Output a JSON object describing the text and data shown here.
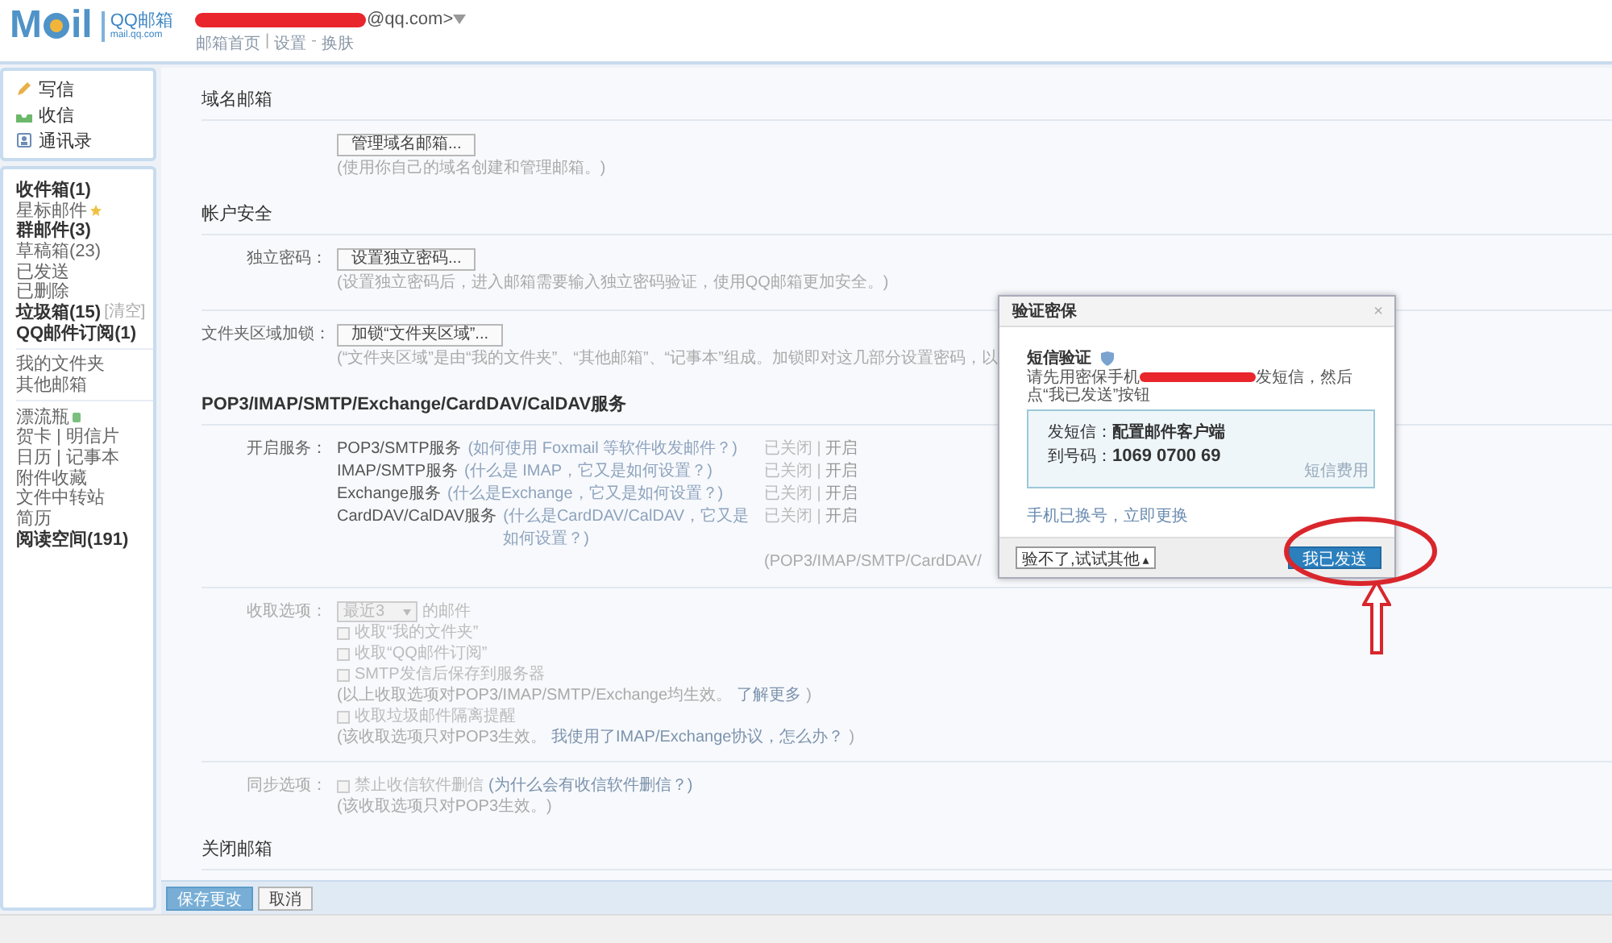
{
  "header": {
    "logo_left": "M",
    "logo_right": "il",
    "brand": "QQ邮箱",
    "brand_sub": "mail.qq.com",
    "account_suffix": "@qq.com>",
    "nav": [
      {
        "label": "邮箱首页",
        "sep": "|"
      },
      {
        "label": "设置",
        "sep": "-"
      },
      {
        "label": "换肤"
      }
    ]
  },
  "sidebar": {
    "actions": [
      {
        "kind": "write",
        "label": "写信"
      },
      {
        "kind": "receive",
        "label": "收信"
      },
      {
        "kind": "contacts",
        "label": "通讯录"
      }
    ],
    "groups": [
      [
        {
          "label": "收件箱(1)",
          "unread": true
        },
        {
          "label": "星标邮件",
          "unread": false,
          "star": true
        },
        {
          "label": "群邮件(3)",
          "unread": true
        },
        {
          "label": "草稿箱(23)",
          "unread": false
        },
        {
          "label": "已发送",
          "unread": false
        },
        {
          "label": "已删除",
          "unread": false
        },
        {
          "label": "垃圾箱(15)",
          "unread": true,
          "extra": "[清空]"
        },
        {
          "label": "QQ邮件订阅(1)",
          "unread": true
        }
      ],
      [
        {
          "label": "我的文件夹",
          "unread": false
        },
        {
          "label": "其他邮箱",
          "unread": false
        }
      ],
      [
        {
          "label": "漂流瓶",
          "unread": false,
          "bottle": true
        },
        {
          "label": "贺卡 | 明信片",
          "unread": false
        },
        {
          "label": "日历 | 记事本",
          "unread": false
        },
        {
          "label": "附件收藏",
          "unread": false
        },
        {
          "label": "文件中转站",
          "unread": false
        },
        {
          "label": "简历",
          "unread": false
        },
        {
          "label": "阅读空间(191)",
          "unread": true
        }
      ]
    ]
  },
  "sections": [
    {
      "title": "域名邮箱",
      "rows": [
        {
          "button": "管理域名邮箱...",
          "note": "(使用你自己的域名创建和管理邮箱。)"
        }
      ]
    },
    {
      "title": "帐户安全",
      "rows": [
        {
          "label": "独立密码：",
          "button": "设置独立密码...",
          "note": "(设置独立密码后，进入邮箱需要输入独立密码验证，使用QQ邮箱更加安全。)"
        },
        {
          "label": "文件夹区域加锁：",
          "button": "加锁“文件夹区域”...",
          "note": "(“文件夹区域”是由“我的文件夹”、“其他邮箱”、“记事本”组成。加锁即对这几部分设置密码，以"
        }
      ]
    },
    {
      "title": "POP3/IMAP/SMTP/Exchange/CardDAV/CalDAV服务",
      "services_label": "开启服务：",
      "services": [
        {
          "name": "POP3/SMTP服务",
          "hint": "(如何使用 Foxmail 等软件收发邮件？)",
          "status": "已关闭",
          "sep": "|",
          "action": "开启"
        },
        {
          "name": "IMAP/SMTP服务",
          "hint": "(什么是 IMAP，它又是如何设置？)",
          "status": "已关闭",
          "sep": "|",
          "action": "开启"
        },
        {
          "name": "Exchange服务",
          "hint": "(什么是Exchange，它又是如何设置？)",
          "status": "已关闭",
          "sep": "|",
          "action": "开启"
        },
        {
          "name": "CardDAV/CalDAV服务",
          "hint": "(什么是CardDAV/CalDAV，它又是如何设置？)",
          "status": "已关闭",
          "sep": "|",
          "action": "开启"
        }
      ],
      "services_note": "(POP3/IMAP/SMTP/CardDAV/",
      "receive": {
        "label": "收取选项：",
        "disabled": true,
        "select": "最近3",
        "select_suffix": "的邮件",
        "items": [
          {
            "kind": "checkbox",
            "label": "收取“我的文件夹”",
            "checked": false
          },
          {
            "kind": "checkbox",
            "label": "收取“QQ邮件订阅”",
            "checked": false
          },
          {
            "kind": "checkbox",
            "label": "SMTP发信后保存到服务器",
            "checked": false
          },
          {
            "kind": "note",
            "text": "(以上收取选项对POP3/IMAP/SMTP/Exchange均生效。",
            "link": "了解更多",
            "tail": ")"
          },
          {
            "kind": "checkbox",
            "label": "收取垃圾邮件隔离提醒",
            "checked": false
          },
          {
            "kind": "note",
            "text": "(该收取选项只对POP3生效。",
            "link": "我使用了IMAP/Exchange协议，怎么办？",
            "tail": ")"
          }
        ]
      },
      "sync": {
        "label": "同步选项：",
        "disabled": true,
        "items": [
          {
            "kind": "checkbox",
            "label": "禁止收信软件删信",
            "checked": false,
            "link": "(为什么会有收信软件删信？)"
          },
          {
            "kind": "note",
            "text": "(该收取选项只对POP3生效。)"
          }
        ]
      }
    },
    {
      "title": "关闭邮箱"
    }
  ],
  "footer": {
    "buttons": [
      {
        "label": "保存更改",
        "primary": true
      },
      {
        "label": "取消",
        "primary": false
      }
    ]
  },
  "dialog": {
    "title": "验证密保",
    "close": "×",
    "heading": "短信验证",
    "instruction_before": "请先用密保手机",
    "instruction_after": "发短信，然后点“我已发送”按钮",
    "sms_label": "发短信：",
    "sms_value": "配置邮件客户端",
    "to_label": "到号码：",
    "to_value": "1069 0700 69",
    "fee_link": "短信费用",
    "change_link": "手机已换号，立即更换",
    "other_button": "验不了,试试其他",
    "other_caret": "▴",
    "confirm_button": "我已发送"
  }
}
